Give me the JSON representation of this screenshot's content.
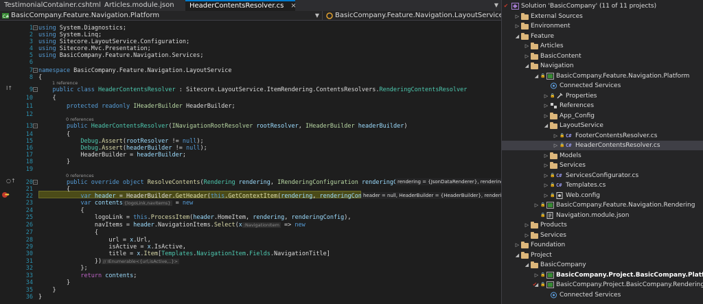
{
  "tabs": [
    {
      "label": "TestimonialContainer.cshtml",
      "active": false
    },
    {
      "label": "Articles.module.json",
      "active": false
    },
    {
      "label": "HeaderContentsResolver.cs",
      "active": true,
      "close": "×"
    }
  ],
  "navbar": {
    "project": "BasicCompany.Feature.Navigation.Platform",
    "member": "BasicCompany.Feature.Navigation.LayoutService.HeaderC"
  },
  "editor": {
    "lines": [
      {
        "n": "1",
        "html": "<span class=\"k\">using</span> System.Diagnostics;"
      },
      {
        "n": "2",
        "html": "<span class=\"k\">using</span> System.Linq;"
      },
      {
        "n": "3",
        "html": "<span class=\"k\">using</span> Sitecore.LayoutService.Configuration;"
      },
      {
        "n": "4",
        "html": "<span class=\"k\">using</span> Sitecore.Mvc.Presentation;"
      },
      {
        "n": "5",
        "html": "<span class=\"k\">using</span> BasicCompany.Feature.Navigation.Services;"
      },
      {
        "n": "6",
        "html": ""
      },
      {
        "n": "7",
        "html": "<span class=\"k\">namespace</span> BasicCompany.Feature.Navigation.LayoutService"
      },
      {
        "n": "8",
        "html": "{"
      },
      {
        "n": "9",
        "html": "    <span class=\"k\">public</span> <span class=\"k\">class</span> <span class=\"t\">HeaderContentsResolver</span> : Sitecore.LayoutService.ItemRendering.ContentsResolvers.<span class=\"t\">RenderingContentsResolver</span>"
      },
      {
        "n": "10",
        "html": "    {"
      },
      {
        "n": "11",
        "html": "        <span class=\"k\">protected</span> <span class=\"k\">readonly</span> <span class=\"i\">IHeaderBuilder</span> HeaderBuilder;"
      },
      {
        "n": "12",
        "html": ""
      },
      {
        "n": "13",
        "html": "        <span class=\"k\">public</span> <span class=\"t\">HeaderContentsResolver</span>(<span class=\"i\">INavigationRootResolver</span> <span class=\"p\">rootResolver</span>, <span class=\"i\">IHeaderBuilder</span> <span class=\"p\">headerBuilder</span>)"
      },
      {
        "n": "14",
        "html": "        {"
      },
      {
        "n": "15",
        "html": "            <span class=\"t\">Debug</span>.<span class=\"m\">Assert</span>(<span class=\"p\">rootResolver</span> != <span class=\"k\">null</span>);"
      },
      {
        "n": "16",
        "html": "            <span class=\"t\">Debug</span>.<span class=\"m\">Assert</span>(<span class=\"p\">headerBuilder</span> != <span class=\"k\">null</span>);"
      },
      {
        "n": "17",
        "html": "            HeaderBuilder = <span class=\"p\">headerBuilder</span>;"
      },
      {
        "n": "18",
        "html": "        }"
      },
      {
        "n": "19",
        "html": ""
      },
      {
        "n": "20",
        "html": "        <span class=\"k\">public</span> <span class=\"k\">override</span> <span class=\"k\">object</span> <span class=\"m\">ResolveContents</span>(<span class=\"t\">Rendering</span> <span class=\"p\">rendering</span>, <span class=\"i\">IRenderingConfiguration</span> <span class=\"p\">renderingConfig</span>)"
      },
      {
        "n": "21",
        "html": "        {"
      },
      {
        "n": "22",
        "html": "            <span class=\"k\">var</span> <span class=\"p\">header</span> = HeaderBuilder.<span class=\"m\">GetHeader</span>(<span class=\"k\">this</span>.<span class=\"m\">GetContextItem</span>(<span class=\"p\">rendering</span>, <span class=\"p\">renderingConfig</span>));"
      },
      {
        "n": "23",
        "html": "            <span class=\"k\">var</span> <span class=\"p\">contents</span><span class=\"hint\">{logoLink,navItems}</span> = <span class=\"k\">new</span>"
      },
      {
        "n": "24",
        "html": "            {"
      },
      {
        "n": "25",
        "html": "                logoLink = <span class=\"k\">this</span>.<span class=\"m\">ProcessItem</span>(<span class=\"p\">header</span>.HomeItem, <span class=\"p\">rendering</span>, <span class=\"p\">renderingConfig</span>),"
      },
      {
        "n": "26",
        "html": "                navItems = <span class=\"p\">header</span>.NavigationItems.<span class=\"m\">Select</span>(<span class=\"p\">x</span><span class=\"hint\">:NavigationItem</span> =&gt; <span class=\"k\">new</span>"
      },
      {
        "n": "27",
        "html": "                {"
      },
      {
        "n": "28",
        "html": "                    url = <span class=\"p\">x</span>.Url,"
      },
      {
        "n": "29",
        "html": "                    isActive = <span class=\"p\">x</span>.IsActive,"
      },
      {
        "n": "30",
        "html": "                    title = <span class=\"p\">x</span>.<span class=\"m\">Item</span>[<span class=\"t\">Templates</span>.<span class=\"t\">NavigationItem</span>.<span class=\"t\">Fields</span>.NavigationTitle]"
      },
      {
        "n": "31",
        "html": "                })<span class=\"hint\">// IEnumerable&lt;{url,isActive,..}&gt;</span>"
      },
      {
        "n": "32",
        "html": "            };"
      },
      {
        "n": "33",
        "html": "            <span class=\"hm\">return</span> <span class=\"p\">contents</span>;"
      },
      {
        "n": "34",
        "html": "        }"
      },
      {
        "n": "35",
        "html": "    }"
      },
      {
        "n": "36",
        "html": "}"
      }
    ],
    "annotations": [
      {
        "before": "9",
        "text": "1 reference"
      },
      {
        "before": "13",
        "text": "0 references"
      },
      {
        "before": "20",
        "text": "0 references"
      }
    ],
    "datatips": [
      {
        "line": "20",
        "text": "rendering = {JsonDataRenderer},  renderingC"
      },
      {
        "line": "22",
        "text": "header = null,  HeaderBuilder = {HeaderBuilder},  rendering"
      }
    ]
  },
  "solution": {
    "nodes": [
      {
        "label": "Solution 'BasicCompany' (11 of 11 projects)",
        "type": "solution",
        "arrow": "",
        "check": "✔",
        "lock": false
      },
      {
        "label": "External Sources",
        "type": "folder",
        "arrow": "▷",
        "check": "",
        "lock": false
      },
      {
        "label": "Environment",
        "type": "folder",
        "arrow": "▷",
        "check": "",
        "lock": false
      },
      {
        "label": "Feature",
        "type": "folder",
        "arrow": "◢",
        "check": "",
        "lock": false
      },
      {
        "label": "Articles",
        "type": "folder",
        "arrow": "▷",
        "check": "",
        "lock": false
      },
      {
        "label": "BasicContent",
        "type": "folder",
        "arrow": "▷",
        "check": "",
        "lock": false
      },
      {
        "label": "Navigation",
        "type": "folder",
        "arrow": "◢",
        "check": "",
        "lock": false
      },
      {
        "label": "BasicCompany.Feature.Navigation.Platform",
        "type": "project",
        "arrow": "◢",
        "check": "",
        "lock": true
      },
      {
        "label": "Connected Services",
        "type": "connected",
        "arrow": "",
        "check": "",
        "lock": false
      },
      {
        "label": "Properties",
        "type": "props",
        "arrow": "▷",
        "check": "",
        "lock": true
      },
      {
        "label": "References",
        "type": "refs",
        "arrow": "▷",
        "check": "",
        "lock": false
      },
      {
        "label": "App_Config",
        "type": "folder",
        "arrow": "▷",
        "check": "",
        "lock": false
      },
      {
        "label": "LayoutService",
        "type": "folder",
        "arrow": "◢",
        "check": "",
        "lock": false
      },
      {
        "label": "FooterContentsResolver.cs",
        "type": "cs",
        "arrow": "▷",
        "check": "",
        "lock": true
      },
      {
        "label": "HeaderContentsResolver.cs",
        "type": "cs",
        "arrow": "▷",
        "check": "",
        "lock": true,
        "selected": true
      },
      {
        "label": "Models",
        "type": "folder",
        "arrow": "▷",
        "check": "",
        "lock": false
      },
      {
        "label": "Services",
        "type": "folder",
        "arrow": "▷",
        "check": "",
        "lock": false
      },
      {
        "label": "ServicesConfigurator.cs",
        "type": "cs",
        "arrow": "▷",
        "check": "",
        "lock": true
      },
      {
        "label": "Templates.cs",
        "type": "cs",
        "arrow": "▷",
        "check": "",
        "lock": true
      },
      {
        "label": "Web.config",
        "type": "config",
        "arrow": "▷",
        "check": "",
        "lock": true
      },
      {
        "label": "BasicCompany.Feature.Navigation.Rendering",
        "type": "project",
        "arrow": "▷",
        "check": "",
        "lock": true
      },
      {
        "label": "Navigation.module.json",
        "type": "json",
        "arrow": "",
        "check": "",
        "lock": true
      },
      {
        "label": "Products",
        "type": "folder",
        "arrow": "▷",
        "check": "",
        "lock": false
      },
      {
        "label": "Services",
        "type": "folder",
        "arrow": "▷",
        "check": "",
        "lock": false
      },
      {
        "label": "Foundation",
        "type": "folder",
        "arrow": "▷",
        "check": "",
        "lock": false
      },
      {
        "label": "Project",
        "type": "folder",
        "arrow": "◢",
        "check": "",
        "lock": false
      },
      {
        "label": "BasicCompany",
        "type": "folder",
        "arrow": "◢",
        "check": "",
        "lock": false
      },
      {
        "label": "BasicCompany.Project.BasicCompany.Platform",
        "type": "project",
        "arrow": "▷",
        "check": "",
        "lock": true,
        "bold": true
      },
      {
        "label": "BasicCompany.Project.BasicCompany.Rendering",
        "type": "project",
        "arrow": "◢",
        "check": "✔",
        "lock": true
      },
      {
        "label": "Connected Services",
        "type": "connected",
        "arrow": "",
        "check": "",
        "lock": false
      }
    ]
  },
  "colors": {
    "editor_bg": "#1e1e1e",
    "keyword": "#569cd6",
    "type": "#4ec9b0",
    "interface": "#b8d7a3",
    "method": "#dcdcaa",
    "parameter": "#9cdcfe",
    "line_number": "#2b91af",
    "current_line": "#4b4b18",
    "folder": "#dcb67a"
  }
}
